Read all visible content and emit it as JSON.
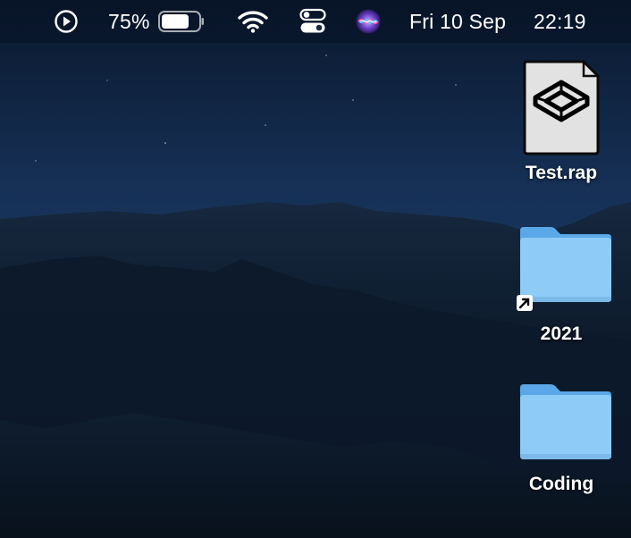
{
  "menubar": {
    "battery_percent": "75%",
    "battery_level": 0.75,
    "date": "Fri 10 Sep",
    "time": "22:19",
    "icons": [
      "play-circle-icon",
      "battery-icon",
      "wifi-icon",
      "control-center-icon",
      "siri-icon"
    ]
  },
  "desktop": {
    "items": [
      {
        "label": "Test.rap",
        "icon": "rap-document-icon"
      },
      {
        "label": "2021",
        "icon": "folder-alias-icon"
      },
      {
        "label": "Coding",
        "icon": "folder-icon"
      }
    ]
  },
  "colors": {
    "sky": "#0f2240",
    "mountains": "#0c1a2b",
    "folder": "#8ecbf6",
    "folder_tab": "#5aa8e8"
  }
}
